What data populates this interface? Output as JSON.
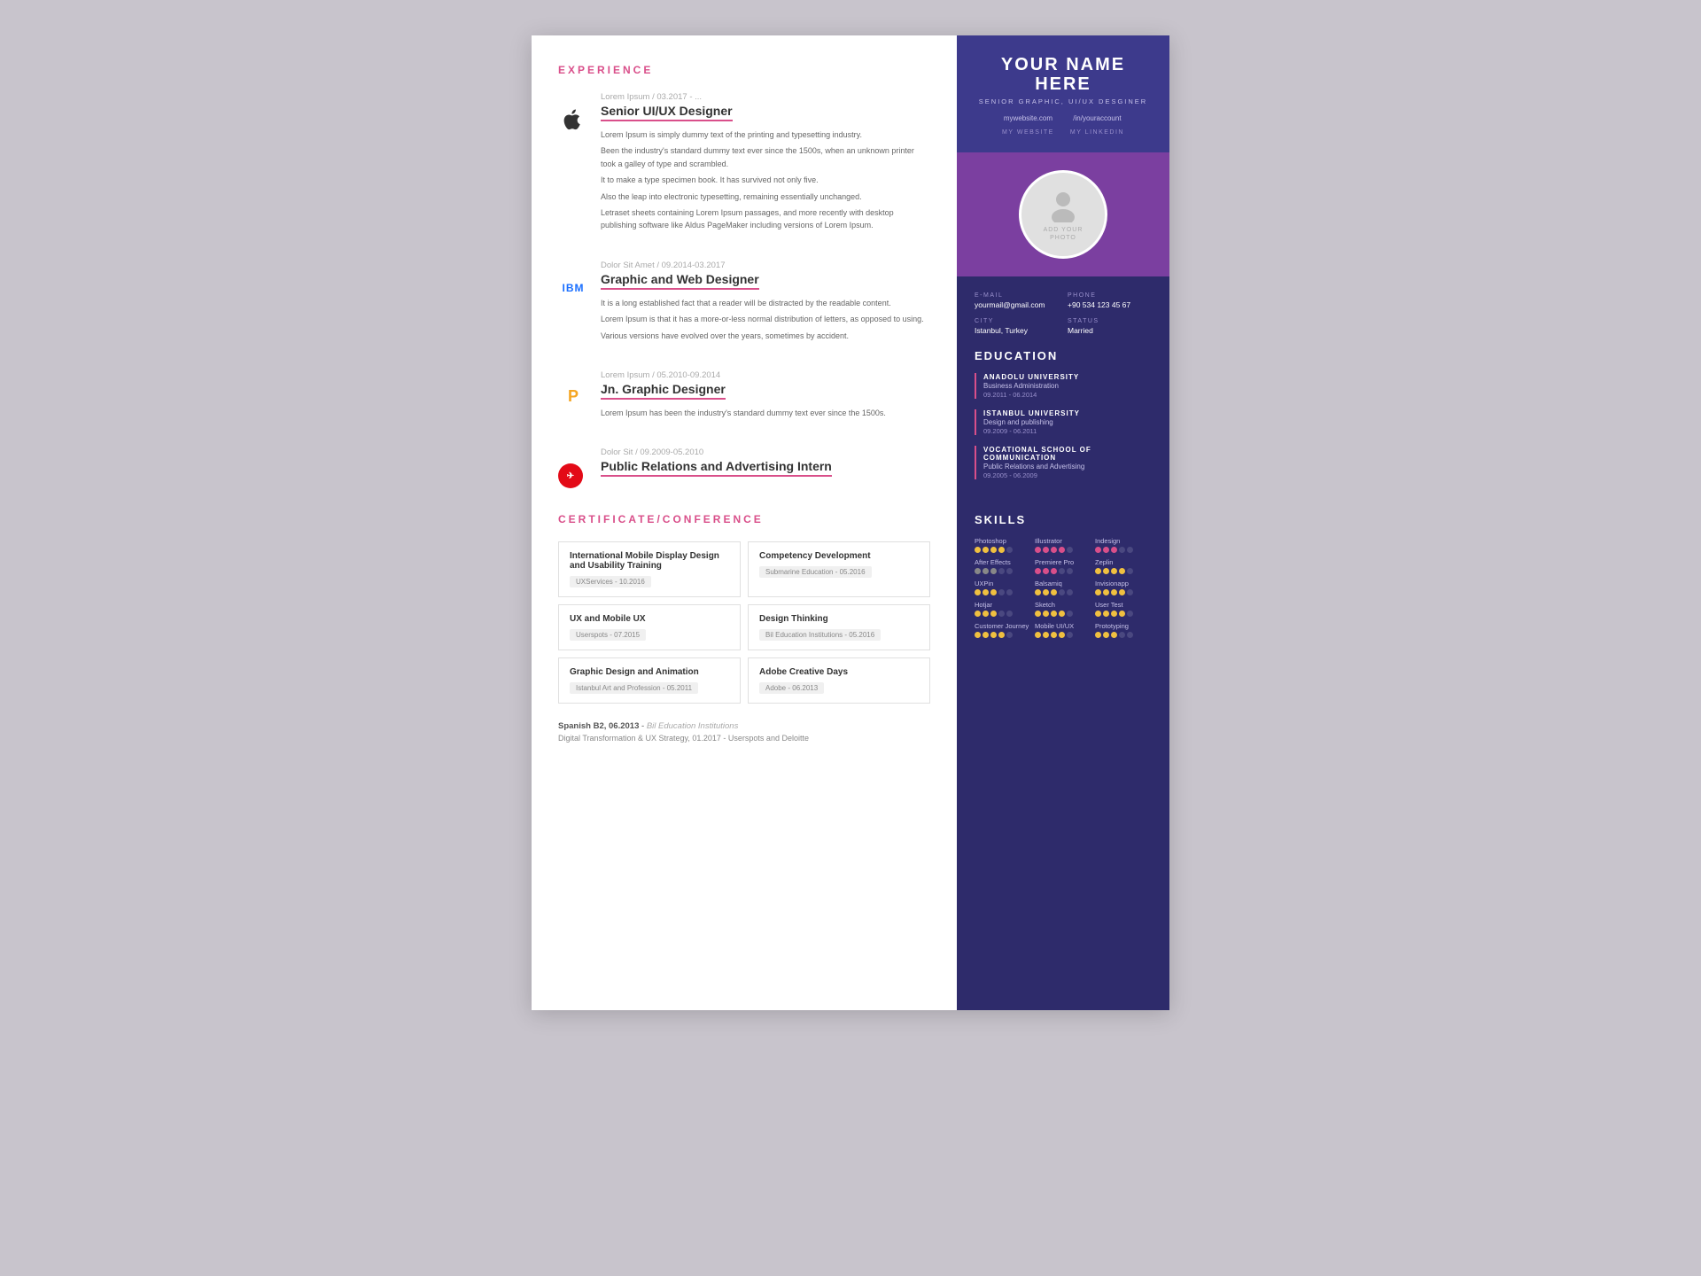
{
  "left": {
    "experience_title": "EXPERIENCE",
    "experiences": [
      {
        "logo": "apple",
        "meta": "Lorem Ipsum / 03.2017 - ...",
        "title": "Senior UI/UX Designer",
        "desc": [
          "Lorem Ipsum is simply dummy text of the printing and typesetting industry.",
          "Been the industry's standard dummy text ever since the 1500s, when an unknown printer took a galley of type and scrambled.",
          "It to make a type specimen book. It has survived not only five.",
          "Also the leap into electronic typesetting, remaining essentially unchanged.",
          "Letraset sheets containing Lorem Ipsum passages, and more recently with desktop publishing software like Aldus PageMaker including versions of Lorem Ipsum."
        ]
      },
      {
        "logo": "ibm",
        "meta": "Dolor Sit Amet / 09.2014-03.2017",
        "title": "Graphic and Web Designer",
        "desc": [
          "It is a long established fact that a reader will be distracted by the readable content.",
          "Lorem Ipsum is that it has a more-or-less normal distribution of letters, as opposed to using.",
          "Various versions have evolved over the years, sometimes by accident."
        ]
      },
      {
        "logo": "p",
        "meta": "Lorem Ipsum / 05.2010-09.2014",
        "title": "Jn. Graphic Designer",
        "desc": [
          "Lorem Ipsum has been the industry's standard dummy text ever since the 1500s."
        ]
      },
      {
        "logo": "turkish",
        "meta": "Dolor Sit / 09.2009-05.2010",
        "title": "Public Relations and Advertising Intern",
        "desc": []
      }
    ],
    "cert_title": "CERTIFICATE/CONFERENCE",
    "certs": [
      {
        "name": "International Mobile Display Design and Usability Training",
        "badge": "UXServices - 10.2016"
      },
      {
        "name": "Competency Development",
        "badge": "Submarine Education - 05.2016"
      },
      {
        "name": "UX and Mobile UX",
        "badge": "Userspots - 07.2015"
      },
      {
        "name": "Design Thinking",
        "badge": "Bil Education Institutions - 05.2016"
      },
      {
        "name": "Graphic Design and Animation",
        "badge": "Istanbul Art and Profession - 05.2011"
      },
      {
        "name": "Adobe Creative Days",
        "badge": "Adobe - 06.2013"
      }
    ],
    "language_line": "Spanish B2, 06.2013",
    "language_school": "Bil Education Institutions",
    "digital_line": "Digital Transformation & UX Strategy, 01.2017 - Userspots and Deloitte"
  },
  "right": {
    "name": "YOUR NAME HERE",
    "subtitle": "SENIOR GRAPHIC, UI/UX DESGINER",
    "website": "mywebsite.com",
    "website_label": "MY WEBSITE",
    "linkedin": "/in/youraccount",
    "linkedin_label": "MY LINKEDIN",
    "photo_text": "ADD YOUR\nPHOTO",
    "email_label": "E-MAIL",
    "email_value": "yourmail@gmail.com",
    "phone_label": "PHONE",
    "phone_value": "+90 534 123 45 67",
    "city_label": "CITY",
    "city_value": "Istanbul, Turkey",
    "status_label": "STATUS",
    "status_value": "Married",
    "education_title": "EDUCATION",
    "educations": [
      {
        "school": "ANADOLU UNIVERSITY",
        "dept": "Business Administration",
        "dates": "09.2011 - 06.2014"
      },
      {
        "school": "ISTANBUL UNIVERSITY",
        "dept": "Design and publishing",
        "dates": "09.2009 - 06.2011"
      },
      {
        "school": "VOCATIONAL SCHOOL OF COMMUNICATION",
        "dept": "Public Relations and Advertising",
        "dates": "09.2005 - 06.2009"
      }
    ],
    "skills_title": "SKILLS",
    "skills": [
      {
        "name": "Photoshop",
        "filled": 4,
        "total": 5,
        "color": "yellow"
      },
      {
        "name": "Illustrator",
        "filled": 4,
        "total": 5,
        "color": "pink"
      },
      {
        "name": "Indesign",
        "filled": 3,
        "total": 5,
        "color": "pink"
      },
      {
        "name": "After Effects",
        "filled": 3,
        "total": 5,
        "color": "gray"
      },
      {
        "name": "Premiere Pro",
        "filled": 3,
        "total": 5,
        "color": "pink"
      },
      {
        "name": "Zeplin",
        "filled": 4,
        "total": 5,
        "color": "yellow"
      },
      {
        "name": "UXPin",
        "filled": 3,
        "total": 5,
        "color": "yellow"
      },
      {
        "name": "Balsamiq",
        "filled": 3,
        "total": 5,
        "color": "yellow"
      },
      {
        "name": "Invisionapp",
        "filled": 4,
        "total": 5,
        "color": "yellow"
      },
      {
        "name": "Hotjar",
        "filled": 3,
        "total": 5,
        "color": "yellow"
      },
      {
        "name": "Sketch",
        "filled": 4,
        "total": 5,
        "color": "yellow"
      },
      {
        "name": "User Test",
        "filled": 4,
        "total": 5,
        "color": "yellow"
      },
      {
        "name": "Customer Journey",
        "filled": 4,
        "total": 5,
        "color": "yellow"
      },
      {
        "name": "Mobile UI/UX",
        "filled": 4,
        "total": 5,
        "color": "yellow"
      },
      {
        "name": "Prototyping",
        "filled": 3,
        "total": 5,
        "color": "yellow"
      }
    ]
  }
}
